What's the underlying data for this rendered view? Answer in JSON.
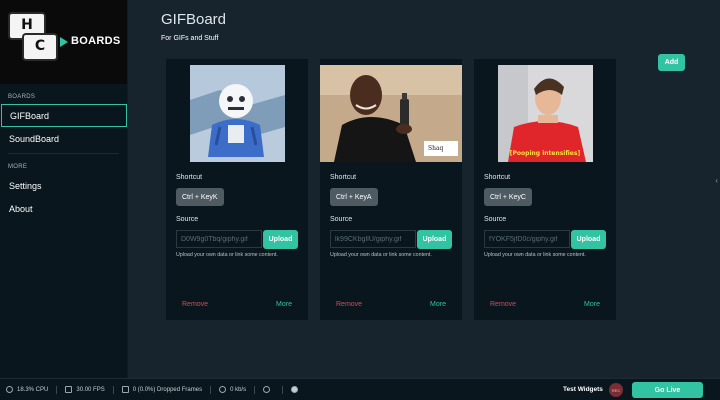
{
  "logo": {
    "key_top": "H",
    "key_bottom": "C",
    "brand": "Boards"
  },
  "sidebar": {
    "boards_section": "BOARDS",
    "boards": [
      {
        "label": "GIFBoard",
        "active": true
      },
      {
        "label": "SoundBoard",
        "active": false
      }
    ],
    "more_section": "MORE",
    "more_items": [
      {
        "label": "Settings"
      },
      {
        "label": "About"
      }
    ]
  },
  "main": {
    "title": "GIFBoard",
    "subtitle": "For GIFs and Stuff",
    "add_label": "Add",
    "cards": [
      {
        "shortcut_label": "Shortcut",
        "shortcut": "Ctrl + KeyK",
        "source_label": "Source",
        "source_value": "D0W9g0Tbq/giphy.gif",
        "upload_label": "Upload",
        "hint": "Upload your own data or link some content.",
        "remove_label": "Remove",
        "more_label": "More"
      },
      {
        "shortcut_label": "Shortcut",
        "shortcut": "Ctrl + KeyA",
        "source_label": "Source",
        "source_value": "lk99CKbgIlU/giphy.gif",
        "upload_label": "Upload",
        "hint": "Upload your own data or link some content.",
        "remove_label": "Remove",
        "more_label": "More",
        "thumb_caption": "Shaq"
      },
      {
        "shortcut_label": "Shortcut",
        "shortcut": "Ctrl + KeyC",
        "source_label": "Source",
        "source_value": "fYOKF5jfD0c/giphy.gif",
        "upload_label": "Upload",
        "hint": "Upload your own data or link some content.",
        "remove_label": "Remove",
        "more_label": "More",
        "thumb_caption": "[Pooping intensifies]"
      }
    ]
  },
  "statusbar": {
    "cpu": "18.3% CPU",
    "fps": "30.00 FPS",
    "dropped": "0 (0.0%) Dropped Frames",
    "bandwidth": "0 kb/s",
    "test_widgets": "Test Widgets",
    "rec": "REC",
    "go_live": "Go Live"
  },
  "colors": {
    "accent": "#31c3a2",
    "danger": "#d94a54",
    "background": "#17242d",
    "panel": "#09161d"
  }
}
